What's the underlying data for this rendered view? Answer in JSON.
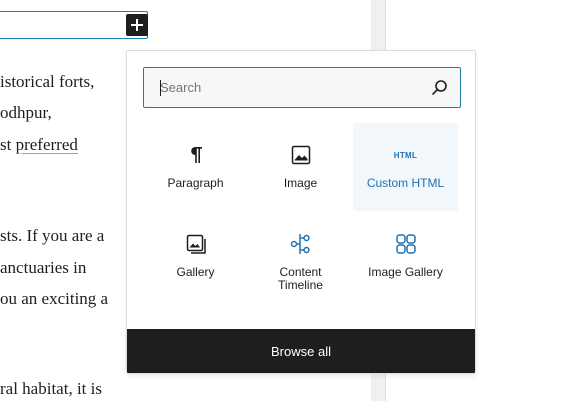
{
  "editor": {
    "paragraph_lines": [
      "istorical forts,",
      "odhpur,",
      "st ",
      "sts. If you are a",
      "anctuaries in",
      "ou an exciting a",
      "ral habitat, it is"
    ],
    "highlighted_word": "preferred"
  },
  "inserter": {
    "toggle_label": "+",
    "search": {
      "placeholder": "Search",
      "value": ""
    },
    "blocks": [
      {
        "label": "Paragraph",
        "icon": "paragraph-icon",
        "active": false
      },
      {
        "label": "Image",
        "icon": "image-icon",
        "active": false
      },
      {
        "label": "Custom HTML",
        "icon": "html-icon",
        "icon_text": "HTML",
        "active": true
      },
      {
        "label": "Gallery",
        "icon": "gallery-icon",
        "active": false
      },
      {
        "label": "Content Timeline",
        "icon": "timeline-icon",
        "active": false
      },
      {
        "label": "Image Gallery",
        "icon": "image-gallery-icon",
        "active": false
      }
    ],
    "browse_all_label": "Browse all"
  },
  "colors": {
    "accent": "#2271b1",
    "focus_border": "#1e7fa8",
    "dark": "#1e1e1e",
    "active_bg": "#f1f7fb"
  }
}
